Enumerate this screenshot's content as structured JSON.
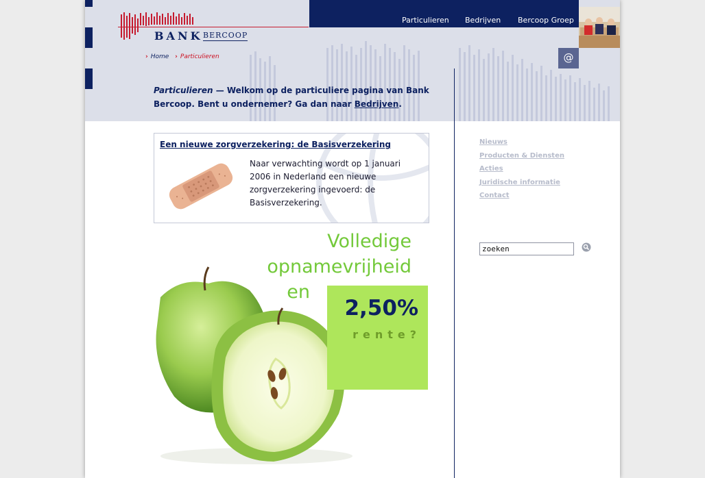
{
  "brand": {
    "bank": "BANK",
    "name": "BERCOOP"
  },
  "topnav": {
    "particulieren": "Particulieren",
    "bedrijven": "Bedrijven",
    "groep": "Bercoop Groep"
  },
  "breadcrumb": {
    "home": "Home",
    "current": "Particulieren"
  },
  "mail_button": "@",
  "intro": {
    "label": "Particulieren",
    "dash": " — ",
    "text": "Welkom op de particuliere pagina van Bank Bercoop. Bent u ondernemer? Ga dan naar ",
    "link": "Bedrijven",
    "end": "."
  },
  "news": {
    "title": "Een nieuwe zorgverzekering: de Basisverzekering",
    "body": "Naar verwachting wordt op 1 januari 2006 in Nederland een nieuwe zorgverzekering ingevoerd: de Basisverzekering."
  },
  "promo": {
    "line1": "Volledige",
    "line2": "opnamevrijheid",
    "line3": "en",
    "rate": "2,50%",
    "rente": "rente?"
  },
  "sidenav": [
    "Nieuws",
    "Producten & Diensten",
    "Acties",
    "Juridische informatie",
    "Contact"
  ],
  "search": {
    "value": "zoeken"
  },
  "colors": {
    "navy": "#0d2160",
    "header_bg": "#dcdfe9",
    "accent_red": "#cc1122",
    "promo_green": "#73c93a",
    "box_green": "#aee65b"
  }
}
